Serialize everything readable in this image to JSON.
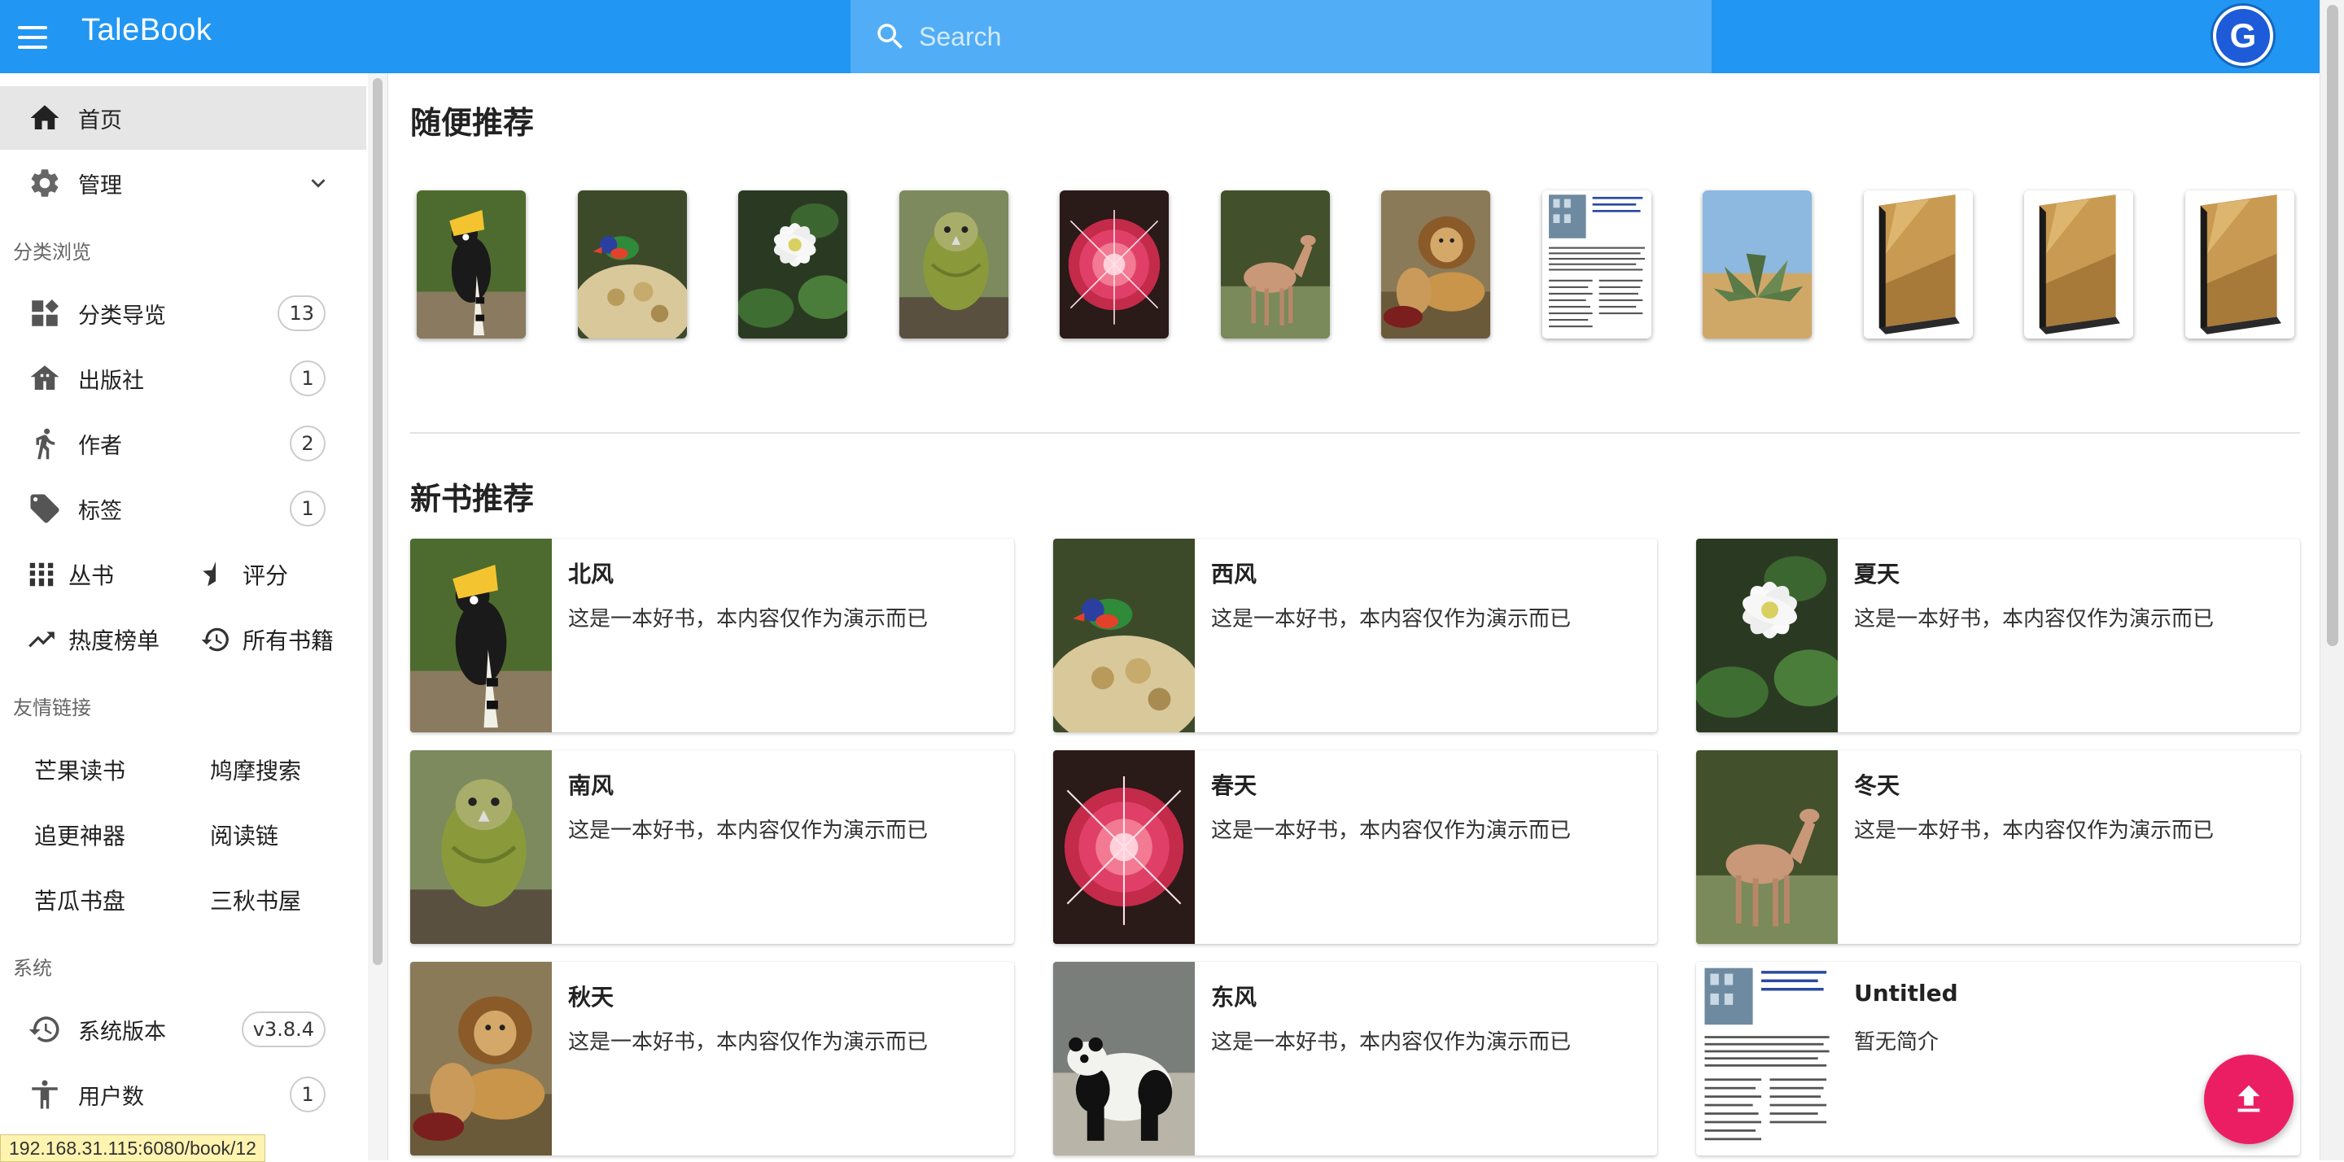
{
  "app": {
    "title": "TaleBook"
  },
  "search": {
    "placeholder": "Search"
  },
  "sidebar": {
    "home": "首页",
    "manage": "管理",
    "browse_section": "分类浏览",
    "browse": [
      {
        "label": "分类导览",
        "count": "13",
        "icon": "category-icon"
      },
      {
        "label": "出版社",
        "count": "1",
        "icon": "publisher-icon"
      },
      {
        "label": "作者",
        "count": "2",
        "icon": "author-icon"
      },
      {
        "label": "标签",
        "count": "1",
        "icon": "tag-icon"
      }
    ],
    "series": "丛书",
    "rating": "评分",
    "hot": "热度榜单",
    "all_books": "所有书籍",
    "friends_section": "友情链接",
    "friends": [
      "芒果读书",
      "鸠摩搜索",
      "追更神器",
      "阅读链",
      "苦瓜书盘",
      "三秋书屋"
    ],
    "system_section": "系统",
    "version_label": "系统版本",
    "version": "v3.8.4",
    "users_label": "用户数",
    "users": "1"
  },
  "main": {
    "random_title": "随便推荐",
    "random_covers": [
      "hornbill",
      "lorikeet",
      "white-flower",
      "kakapo",
      "red-flower",
      "deer",
      "lions",
      "document",
      "desert-plant",
      "book",
      "book",
      "book"
    ],
    "new_title": "新书推荐",
    "books": [
      {
        "title": "北风",
        "desc": "这是一本好书，本内容仅作为演示而已",
        "cover": "hornbill"
      },
      {
        "title": "西风",
        "desc": "这是一本好书，本内容仅作为演示而已",
        "cover": "lorikeet"
      },
      {
        "title": "夏天",
        "desc": "这是一本好书，本内容仅作为演示而已",
        "cover": "white-flower"
      },
      {
        "title": "南风",
        "desc": "这是一本好书，本内容仅作为演示而已",
        "cover": "kakapo"
      },
      {
        "title": "春天",
        "desc": "这是一本好书，本内容仅作为演示而已",
        "cover": "red-flower"
      },
      {
        "title": "冬天",
        "desc": "这是一本好书，本内容仅作为演示而已",
        "cover": "deer"
      },
      {
        "title": "秋天",
        "desc": "这是一本好书，本内容仅作为演示而已",
        "cover": "lions"
      },
      {
        "title": "东风",
        "desc": "这是一本好书，本内容仅作为演示而已",
        "cover": "panda"
      },
      {
        "title": "Untitled",
        "desc": "暂无简介",
        "cover": "document"
      }
    ]
  },
  "status_url": "192.168.31.115:6080/book/12",
  "colors": {
    "appbar": "#2196f3",
    "fab": "#ec1e63",
    "active_nav": "#e6e6e6"
  }
}
